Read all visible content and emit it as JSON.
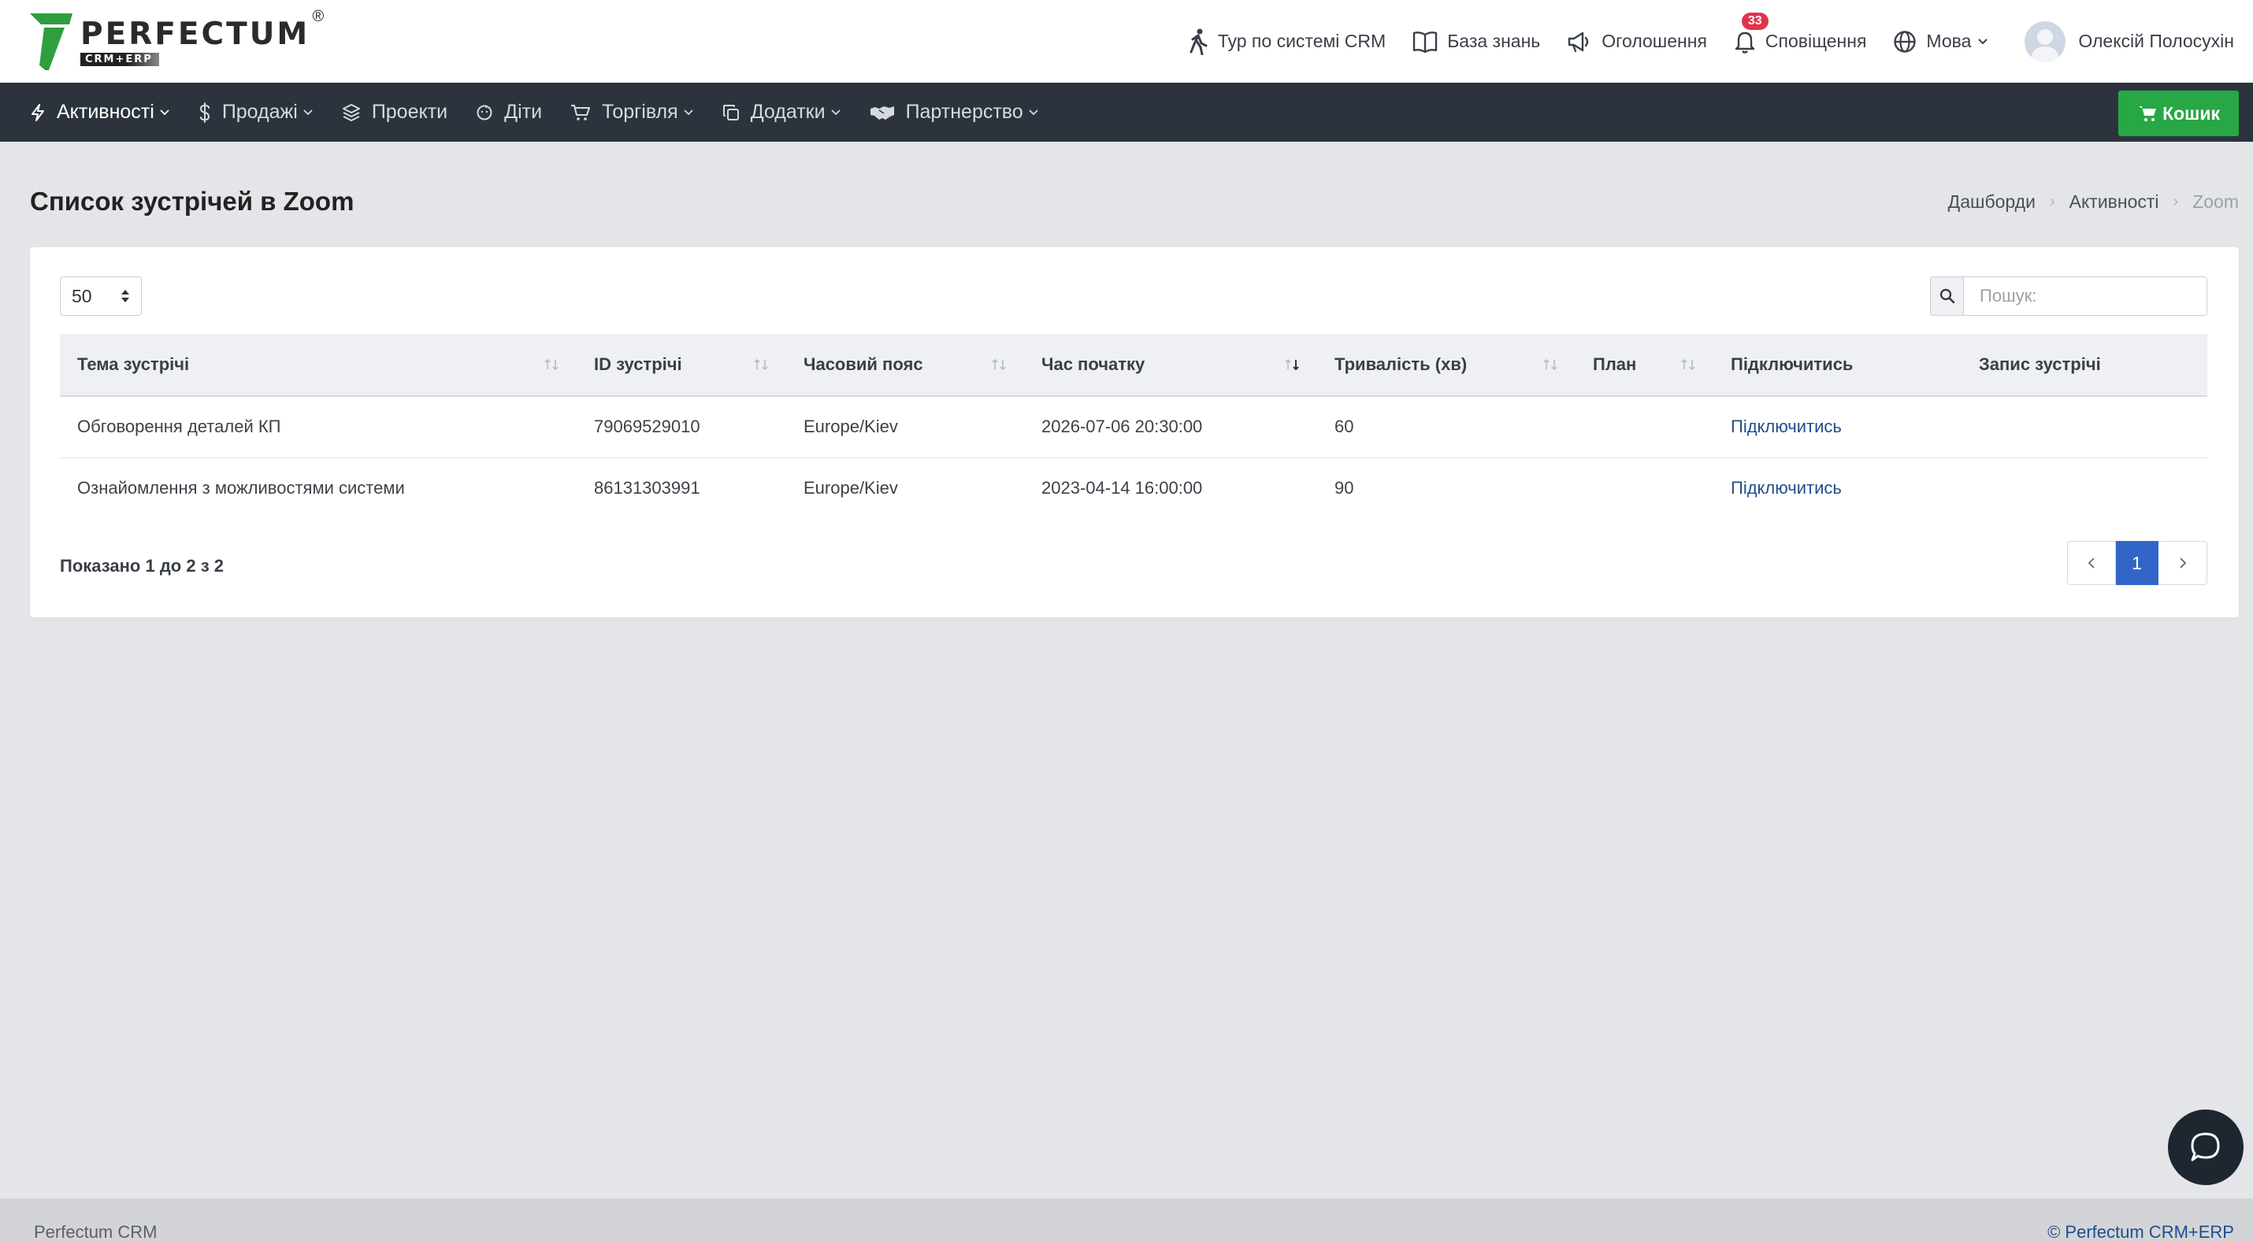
{
  "brand": {
    "name": "PERFECTUM",
    "sub": "CRM+ERP",
    "reg": "®"
  },
  "topnav": {
    "tour": "Тур по системі CRM",
    "kb": "База знань",
    "announcements": "Оголошення",
    "notifications": "Сповіщення",
    "notifications_count": "33",
    "language": "Мова",
    "user": "Олексій Полосухін"
  },
  "navbar": {
    "items": [
      {
        "label": "Активності"
      },
      {
        "label": "Продажі"
      },
      {
        "label": "Проекти"
      },
      {
        "label": "Діти"
      },
      {
        "label": "Торгівля"
      },
      {
        "label": "Додатки"
      },
      {
        "label": "Партнерство"
      }
    ],
    "cart": "Кошик"
  },
  "page": {
    "title": "Список зустрічей в Zoom",
    "breadcrumb": [
      "Дашборди",
      "Активності",
      "Zoom"
    ]
  },
  "table_controls": {
    "page_length": "50",
    "search_placeholder": "Пошук:"
  },
  "table": {
    "columns": [
      "Тема зустрічі",
      "ID зустрічі",
      "Часовий пояс",
      "Час початку",
      "Тривалість (хв)",
      "План",
      "Підключитись",
      "Запис зустрічі"
    ],
    "rows": [
      {
        "topic": "Обговорення деталей КП",
        "id": "79069529010",
        "tz": "Europe/Kiev",
        "start": "2026-07-06 20:30:00",
        "duration": "60",
        "plan": "",
        "join": "Підключитись",
        "record": ""
      },
      {
        "topic": "Ознайомлення з можливостями системи",
        "id": "86131303991",
        "tz": "Europe/Kiev",
        "start": "2023-04-14 16:00:00",
        "duration": "90",
        "plan": "",
        "join": "Підключитись",
        "record": ""
      }
    ]
  },
  "info": "Показано 1 до 2 з 2",
  "pagination": {
    "current": "1"
  },
  "footer": {
    "left": "Perfectum CRM",
    "right": "© Perfectum CRM+ERP"
  },
  "colors": {
    "navbar": "#2c333d",
    "accent": "#3166c8",
    "cart": "#28a745",
    "badge": "#e0344a",
    "link": "#1e4d8c"
  }
}
